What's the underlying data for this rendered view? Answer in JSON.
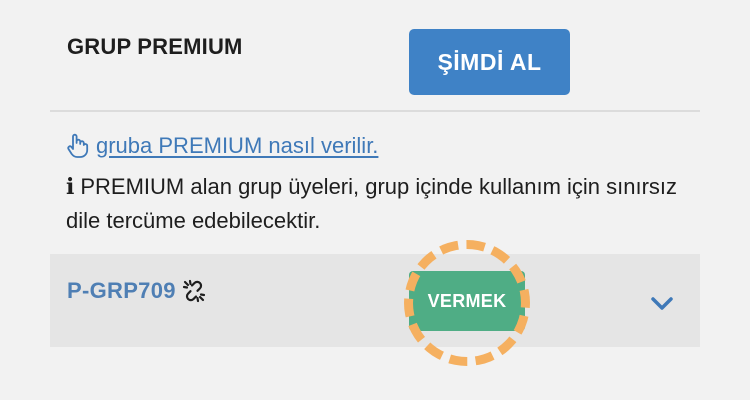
{
  "header": {
    "title": "GRUP PREMIUM",
    "buy_label": "ŞİMDİ AL"
  },
  "howto": {
    "link_text": "gruba PREMIUM nasıl verilir."
  },
  "info": {
    "text": "PREMIUM alan grup üyeleri, grup içinde kullanım için sınırsız dile tercüme edebilecektir."
  },
  "group": {
    "name": "P-GRP709",
    "give_label": "VERMEK"
  },
  "icons": {
    "howto": "pointing-hand-icon",
    "info": "info-icon",
    "group": "unlink-icon",
    "expand": "chevron-down-icon"
  },
  "colors": {
    "primary_button": "#3f82c6",
    "give_button": "#4fad85",
    "link": "#3f79b8",
    "group_name": "#4f7fb4",
    "highlight": "#f5b060",
    "row_background": "#e5e5e5"
  }
}
